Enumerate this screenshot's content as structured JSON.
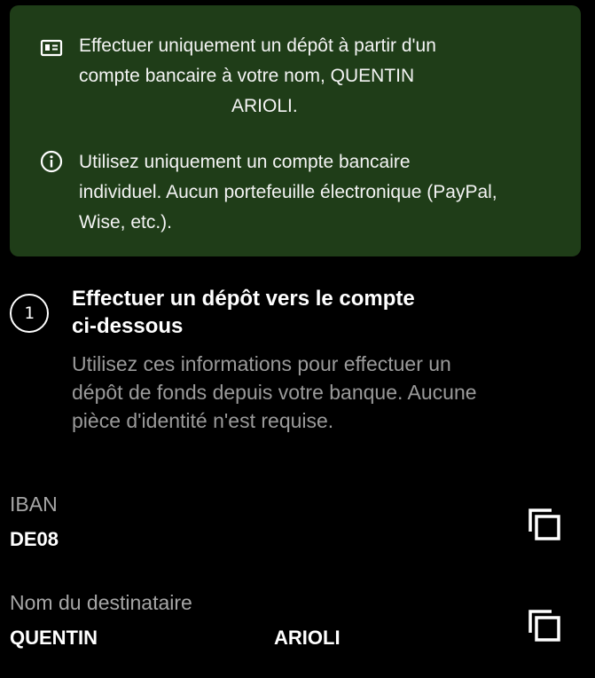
{
  "notice": {
    "icon_card": "id-card-icon",
    "deposit_line1": "Effectuer uniquement un dépôt à partir d'un",
    "deposit_line2": "compte bancaire à votre nom, QUENTIN",
    "deposit_line3": "ARIOLI.",
    "icon_info": "info-icon",
    "account_line1": "Utilisez uniquement un compte bancaire",
    "account_line2": "individuel. Aucun portefeuille électronique (PayPal,",
    "account_line3": "Wise, etc.).",
    "background": "#1f3d18"
  },
  "step": {
    "number": "1",
    "title_line1": "Effectuer un dépôt vers le compte",
    "title_line2": "ci-dessous",
    "desc_line1": "Utilisez ces informations pour effectuer un",
    "desc_line2": "dépôt de fonds depuis votre banque. Aucune",
    "desc_line3": "pièce d'identité n'est requise."
  },
  "fields": {
    "iban": {
      "label": "IBAN",
      "value": "DE08",
      "copy_icon": "copy-icon"
    },
    "recipient": {
      "label": "Nom du destinataire",
      "first_name": "QUENTIN",
      "last_name": "ARIOLI",
      "copy_icon": "copy-icon"
    }
  }
}
